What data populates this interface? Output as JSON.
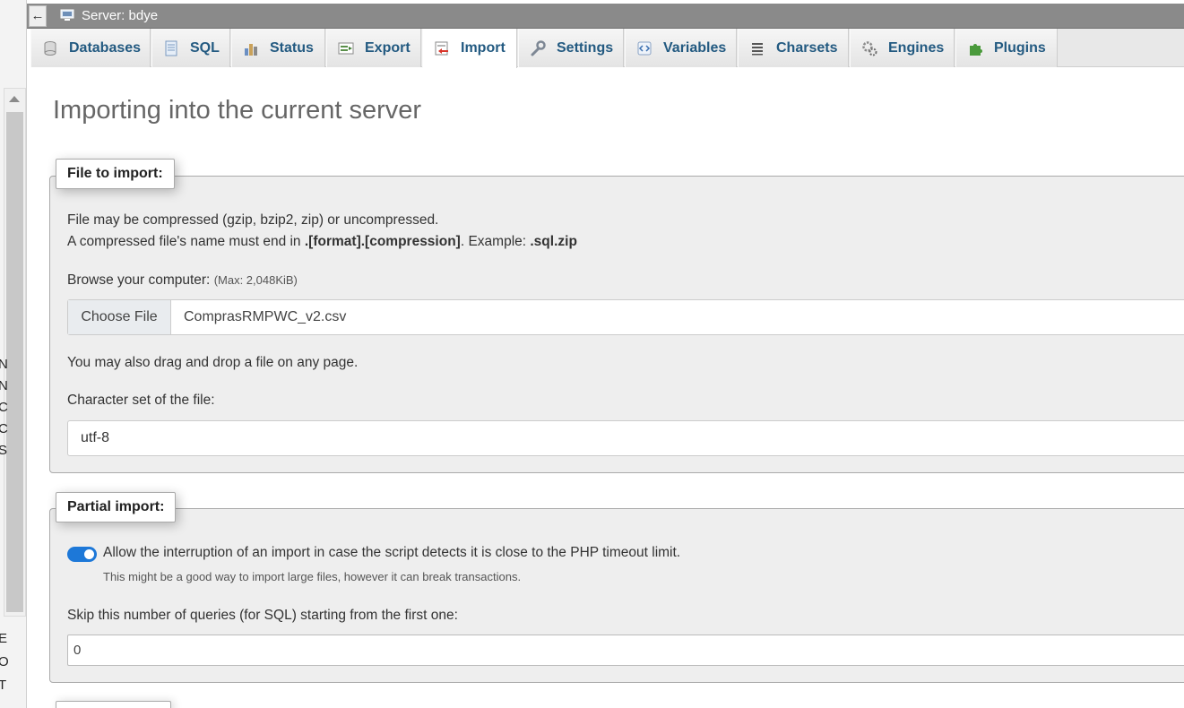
{
  "server": {
    "title": "Server: bdye",
    "back_glyph": "←"
  },
  "left_panel": {
    "visible_chars": [
      "N",
      "N",
      "C",
      "C",
      "S"
    ],
    "visible_chars_lower": [
      "E",
      "O",
      "T"
    ]
  },
  "tabs": [
    {
      "label": "Databases",
      "icon": "database-icon",
      "active": false
    },
    {
      "label": "SQL",
      "icon": "sql-icon",
      "active": false
    },
    {
      "label": "Status",
      "icon": "status-icon",
      "active": false
    },
    {
      "label": "Export",
      "icon": "export-icon",
      "active": false
    },
    {
      "label": "Import",
      "icon": "import-icon",
      "active": true
    },
    {
      "label": "Settings",
      "icon": "wrench-icon",
      "active": false
    },
    {
      "label": "Variables",
      "icon": "variables-icon",
      "active": false
    },
    {
      "label": "Charsets",
      "icon": "charsets-icon",
      "active": false
    },
    {
      "label": "Engines",
      "icon": "engines-icon",
      "active": false
    },
    {
      "label": "Plugins",
      "icon": "puzzle-icon",
      "active": false
    }
  ],
  "page": {
    "title": "Importing into the current server"
  },
  "file_to_import": {
    "legend": "File to import:",
    "line1": "File may be compressed (gzip, bzip2, zip) or uncompressed.",
    "line2_prefix": "A compressed file's name must end in ",
    "line2_format": ".[format].[compression]",
    "line2_middle": ". Example: ",
    "line2_example": ".sql.zip",
    "browse_label": "Browse your computer: ",
    "max_size": "(Max: 2,048KiB)",
    "choose_button": "Choose File",
    "chosen_file": "ComprasRMPWC_v2.csv",
    "drag_drop": "You may also drag and drop a file on any page.",
    "charset_label": "Character set of the file:",
    "charset_value": "utf-8"
  },
  "partial_import": {
    "legend": "Partial import:",
    "allow_interrupt_label": "Allow the interruption of an import in case the script detects it is close to the PHP timeout limit.",
    "allow_interrupt_checked": true,
    "hint": "This might be a good way to import large files, however it can break transactions.",
    "skip_label": "Skip this number of queries (for SQL) starting from the first one:",
    "skip_value": "0"
  },
  "colors": {
    "tab_text": "#235a81",
    "toggle_on": "#1d78d8",
    "server_bar": "#8a8a8a"
  }
}
